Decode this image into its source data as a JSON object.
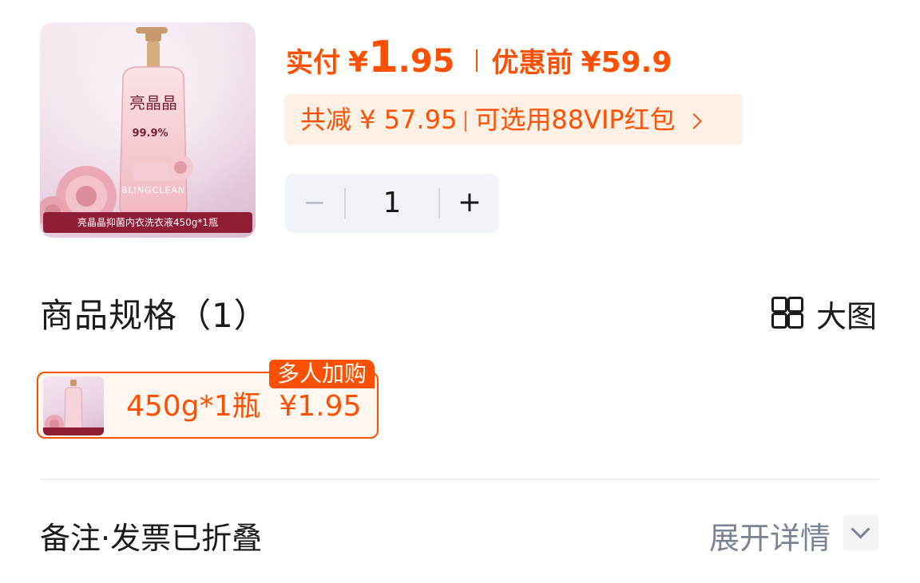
{
  "product": {
    "image_caption": "亮晶晶抑菌内衣洗衣液450g*1瓶",
    "image_brand_text": "BLINGCLEAN",
    "image_logo_text": "亮晶晶",
    "image_badge_text": "99.9%"
  },
  "price": {
    "pay_label": "实付",
    "pay_currency": "¥",
    "pay_integer": "1",
    "pay_decimal": ".95",
    "original_label": "优惠前",
    "original_price": "¥59.9"
  },
  "discount": {
    "saved_text": "共减 ¥ 57.95",
    "coupon_text": "可选用88VIP红包"
  },
  "quantity": {
    "minus": "−",
    "value": "1",
    "plus": "+"
  },
  "spec": {
    "title": "商品规格（1）",
    "big_image_label": "大图",
    "options": [
      {
        "label": "450g*1瓶",
        "price": "¥1.95",
        "tag": "多人加购",
        "selected": true
      }
    ]
  },
  "notes": {
    "label": "备注·发票已折叠",
    "expand_label": "展开详情"
  },
  "colors": {
    "accent": "#ff5000",
    "pill_background": "#fff0e6",
    "stepper_background": "#f0f3f7",
    "caption_bar": "#8e1d35"
  }
}
